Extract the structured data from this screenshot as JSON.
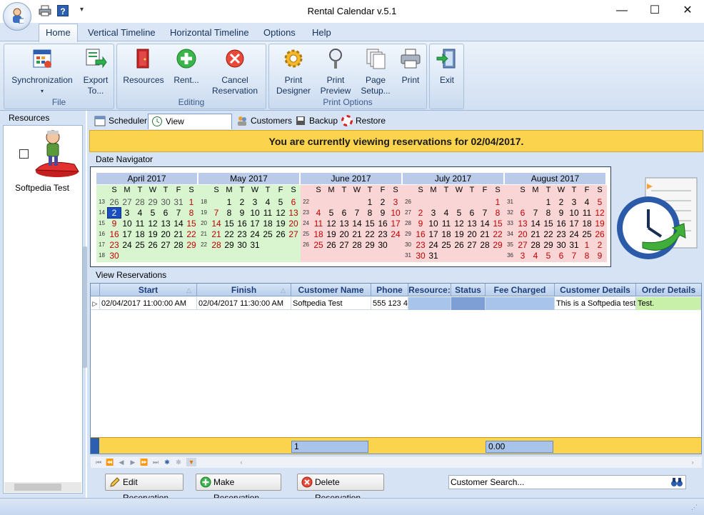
{
  "window": {
    "title": "Rental Calendar v.5.1",
    "minimize": "—",
    "maximize": "☐",
    "close": "✕"
  },
  "quick_access": {
    "help": "?",
    "dropdown": "▾"
  },
  "ribbon_tabs": [
    "Home",
    "Vertical Timeline",
    "Horizontal Timeline",
    "Options",
    "Help"
  ],
  "ribbon_groups": {
    "file": {
      "label": "File",
      "sync": "Synchronization",
      "export": "Export To..."
    },
    "editing": {
      "label": "Editing",
      "resources": "Resources",
      "rent": "Rent...",
      "cancel": "Cancel Reservation"
    },
    "print": {
      "label": "Print Options",
      "designer": "Print Designer",
      "preview": "Print Preview",
      "setup": "Page Setup...",
      "print": "Print"
    },
    "exit": {
      "label": "Exit"
    }
  },
  "resources_panel": {
    "title": "Resources",
    "items": [
      {
        "name": "Softpedia Test"
      }
    ]
  },
  "sub_tabs": [
    "Scheduler",
    "View Reservations",
    "Customers",
    "Backup",
    "Restore"
  ],
  "banner": "You are currently viewing reservations for 02/04/2017.",
  "date_navigator": {
    "label": "Date Navigator",
    "dow": [
      "S",
      "M",
      "T",
      "W",
      "T",
      "F",
      "S"
    ],
    "months": [
      {
        "name": "April 2017",
        "tint": "green",
        "weeks": [
          "13",
          "14",
          "15",
          "16",
          "17",
          "18"
        ],
        "days": [
          [
            "26",
            "27",
            "28",
            "29",
            "30",
            "31",
            "1"
          ],
          [
            "2",
            "3",
            "4",
            "5",
            "6",
            "7",
            "8"
          ],
          [
            "9",
            "10",
            "11",
            "12",
            "13",
            "14",
            "15"
          ],
          [
            "16",
            "17",
            "18",
            "19",
            "20",
            "21",
            "22"
          ],
          [
            "23",
            "24",
            "25",
            "26",
            "27",
            "28",
            "29"
          ],
          [
            "30",
            "",
            "",
            "",
            "",
            "",
            ""
          ]
        ]
      },
      {
        "name": "May 2017",
        "tint": "green",
        "weeks": [
          "18",
          "19",
          "20",
          "21",
          "22"
        ],
        "days": [
          [
            "",
            "1",
            "2",
            "3",
            "4",
            "5",
            "6"
          ],
          [
            "7",
            "8",
            "9",
            "10",
            "11",
            "12",
            "13"
          ],
          [
            "14",
            "15",
            "16",
            "17",
            "18",
            "19",
            "20"
          ],
          [
            "21",
            "22",
            "23",
            "24",
            "25",
            "26",
            "27"
          ],
          [
            "28",
            "29",
            "30",
            "31",
            "",
            "",
            ""
          ]
        ]
      },
      {
        "name": "June 2017",
        "tint": "pink",
        "weeks": [
          "22",
          "23",
          "24",
          "25",
          "26"
        ],
        "days": [
          [
            "",
            "",
            "",
            "",
            "1",
            "2",
            "3"
          ],
          [
            "4",
            "5",
            "6",
            "7",
            "8",
            "9",
            "10"
          ],
          [
            "11",
            "12",
            "13",
            "14",
            "15",
            "16",
            "17"
          ],
          [
            "18",
            "19",
            "20",
            "21",
            "22",
            "23",
            "24"
          ],
          [
            "25",
            "26",
            "27",
            "28",
            "29",
            "30",
            ""
          ]
        ]
      },
      {
        "name": "July 2017",
        "tint": "pink",
        "weeks": [
          "26",
          "27",
          "28",
          "29",
          "30",
          "31"
        ],
        "days": [
          [
            "",
            "",
            "",
            "",
            "",
            "",
            "1"
          ],
          [
            "2",
            "3",
            "4",
            "5",
            "6",
            "7",
            "8"
          ],
          [
            "9",
            "10",
            "11",
            "12",
            "13",
            "14",
            "15"
          ],
          [
            "16",
            "17",
            "18",
            "19",
            "20",
            "21",
            "22"
          ],
          [
            "23",
            "24",
            "25",
            "26",
            "27",
            "28",
            "29"
          ],
          [
            "30",
            "31",
            "",
            "",
            "",
            "",
            ""
          ]
        ]
      },
      {
        "name": "August 2017",
        "tint": "pink",
        "weeks": [
          "31",
          "32",
          "33",
          "34",
          "35",
          "36"
        ],
        "days": [
          [
            "",
            "",
            "1",
            "2",
            "3",
            "4",
            "5"
          ],
          [
            "6",
            "7",
            "8",
            "9",
            "10",
            "11",
            "12"
          ],
          [
            "13",
            "14",
            "15",
            "16",
            "17",
            "18",
            "19"
          ],
          [
            "20",
            "21",
            "22",
            "23",
            "24",
            "25",
            "26"
          ],
          [
            "27",
            "28",
            "29",
            "30",
            "31",
            "1",
            "2"
          ],
          [
            "3",
            "4",
            "5",
            "6",
            "7",
            "8",
            "9"
          ]
        ]
      }
    ],
    "selected": "2"
  },
  "view_reservations": {
    "label": "View Reservations",
    "columns": [
      "Start",
      "Finish",
      "Customer Name",
      "Phone",
      "Resource:",
      "Status",
      "Fee Charged",
      "Customer Details",
      "Order Details"
    ],
    "rows": [
      {
        "start": "02/04/2017 11:00:00 AM",
        "finish": "02/04/2017 11:30:00 AM",
        "customer": "Softpedia Test",
        "phone": "555 123 4",
        "resource": "",
        "status": "",
        "fee": "",
        "details": "This is a Softpedia test",
        "order": "Test."
      }
    ],
    "summary": {
      "count": "1",
      "fee_total": "0.00"
    }
  },
  "actions": {
    "edit": "Edit Reservation",
    "make": "Make Reservation",
    "delete": "Delete Reservation"
  },
  "search": {
    "value": "Customer Search..."
  },
  "colors": {
    "banner": "#fcd34d",
    "green_month": "#d9f5d0",
    "pink_month": "#f9d5d5",
    "accent": "#1a4fc2"
  }
}
